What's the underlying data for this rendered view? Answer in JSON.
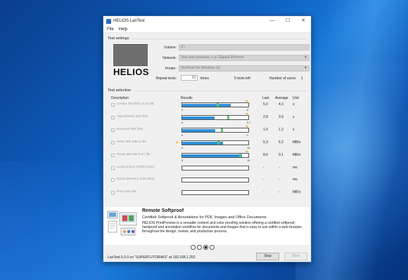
{
  "window": {
    "title": "HELIOS LanTest"
  },
  "window_controls": {
    "minimize": "—",
    "maximize": "☐",
    "close": "✕"
  },
  "menu": [
    "File",
    "Help"
  ],
  "test_settings": {
    "title": "Test settings",
    "logo_text": "HELIOS",
    "volume_label": "Volume:",
    "volume_value": "Z:\\",
    "network_label": "Network:",
    "network_value": "Very fast networks, e.g. Gigabit Ethernet",
    "printer_label": "Printer:",
    "printer_value": "OneNote for Windows 10",
    "repeat_label": "Repeat tests:",
    "repeat_value": "10",
    "repeat_unit": "times",
    "tests_left": "5 tests left",
    "users_label": "Number of users:",
    "users_value": "1"
  },
  "test_selection": {
    "title": "Test selection",
    "headers": {
      "description": "Description",
      "results": "Results",
      "last": "Last",
      "average": "Average",
      "unit": "Unit"
    },
    "rows": [
      {
        "label": "Create 300 files of 20 kB",
        "checked": true,
        "last": "5.9",
        "avg": "4.3",
        "unit": "s",
        "scale_start": "0",
        "scale_end": "6",
        "fill": 0.73,
        "avg_marker": 0.52,
        "marker": "top",
        "marker_pos": 0.97
      },
      {
        "label": "Open/Close 300 files",
        "checked": true,
        "last": "2.8",
        "avg": "3.9",
        "unit": "s",
        "scale_start": "0",
        "scale_end": "5.7",
        "fill": 0.49,
        "avg_marker": 0.68,
        "marker": "top",
        "marker_pos": 0.97
      },
      {
        "label": "Remove 300 files",
        "checked": true,
        "last": "1.0",
        "avg": "1.2",
        "unit": "s",
        "scale_start": "0",
        "scale_end": "2",
        "fill": 0.5,
        "avg_marker": 0.58,
        "marker": "top",
        "marker_pos": 0.97
      },
      {
        "label": "Write 300 MB to file",
        "checked": true,
        "last": "5.3",
        "avg": "6.2",
        "unit": "MB/s",
        "scale_start": "0",
        "scale_end": "10",
        "fill": 0.62,
        "avg_marker": 0.53,
        "marker": "left",
        "marker_pos": 0
      },
      {
        "label": "Read 300 MB from file",
        "checked": true,
        "last": "8.6",
        "avg": "9.1",
        "unit": "MB/s",
        "scale_start": "0",
        "scale_end": "10",
        "fill": 0.9,
        "avg_marker": 0.86,
        "marker": "top",
        "marker_pos": 0.97
      },
      {
        "label": "Lock/Unlock 16000 times",
        "checked": false,
        "last": "-",
        "avg": "-",
        "unit": "ms"
      },
      {
        "label": "Read directory (640 files)",
        "checked": false,
        "last": "-",
        "avg": "-",
        "unit": "ms"
      },
      {
        "label": "Print 300 MB",
        "checked": false,
        "last": "-",
        "avg": "-",
        "unit": "MB/s"
      }
    ]
  },
  "ad": {
    "title": "Remote Softproof",
    "subtitle": "Certified Softproof & Annotations for PDF, Images and Office Documents",
    "body": "HELIOS PrintPreview is a versatile content and color proofing solution offering a certified softproof, hardproof and annotation workflow for documents and images that is easy to use within a web browser, throughout the design, review, and production process.",
    "page_count": 4,
    "active_page": 3
  },
  "status": "LanTest 6.0.0 on \"SUPERTUTORIAIS\" at 192.168.1.252",
  "buttons": {
    "stop": "Stop",
    "start": "Start"
  }
}
